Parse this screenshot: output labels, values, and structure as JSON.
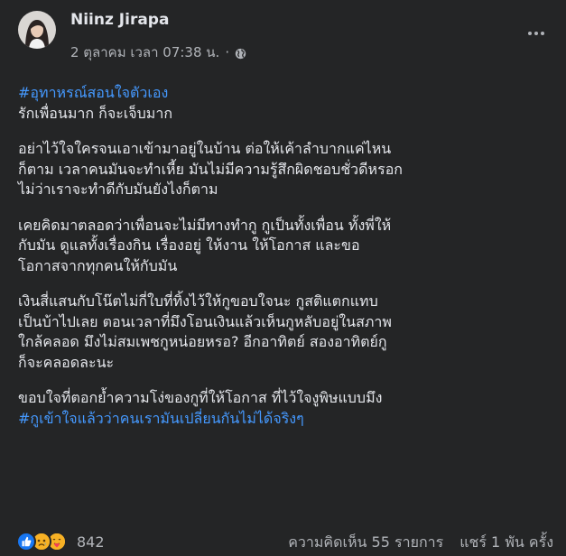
{
  "post": {
    "author": "Niinz Jirapa",
    "timestamp": "2 ตุลาคม เวลา 07:38 น.",
    "meta_separator": "·",
    "privacy_icon": "globe-icon",
    "body": {
      "p1_hashtag": "#อุทาหรณ์สอนใจตัวเอง",
      "p1_line": "รักเพื่อนมาก ก็จะเจ็บมาก",
      "p2_l1": "อย่าไว้ใจใครจนเอาเข้ามาอยู่ในบ้าน ต่อให้เค้าลำบากแค่ไหน",
      "p2_l2": "ก็ตาม เวลาคนมันจะทำเหี้ย มันไม่มีความรู้สึกผิดชอบชั่วดีหรอก",
      "p2_l3": "ไม่ว่าเราจะทำดีกับมันยังไงก็ตาม",
      "p3_l1": "เคยคิดมาตลอดว่าเพื่อนจะไม่มีทางทำกู กูเป็นทั้งเพื่อน ทั้งพี่ให้",
      "p3_l2": "กับมัน ดูแลทั้งเรื่องกิน เรื่องอยู่ ให้งาน ให้โอกาส และขอ",
      "p3_l3": "โอกาสจากทุกคนให้กับมัน",
      "p4_l1": "เงินสี่แสนกับโน๊ตไม่กี่ใบที่ทิ้งไว้ให้กูขอบใจนะ กูสติแตกแทบ",
      "p4_l2": "เป็นบ้าไปเลย ตอนเวลาที่มึงโอนเงินแล้วเห็นกูหลับอยู่ในสภาพ",
      "p4_l3": "ใกล้คลอด มึงไม่สมเพชกูหน่อยหรอ? อีกอาทิตย์ สองอาทิตย์กู",
      "p4_l4": "ก็จะคลอดละนะ",
      "p5_line": "ขอบใจที่ตอกย้ำความโง่ของกูที่ให้โอกาส ที่ไว้ใจงูพิษแบบมึง",
      "p5_hashtag": "#กูเข้าใจแล้วว่าคนเรามันเปลี่ยนกันไม่ได้จริงๆ"
    },
    "footer": {
      "reactions": [
        "like-icon",
        "sad-icon",
        "care-icon"
      ],
      "reaction_count": "842",
      "comments": "ความคิดเห็น 55 รายการ",
      "shares": "แชร์ 1 พัน ครั้ง"
    }
  },
  "colors": {
    "background": "#242526",
    "text_primary": "#e4e6eb",
    "text_secondary": "#b0b3b8",
    "hashtag": "#4599ff",
    "like_blue": "#1877f2",
    "emoji_yellow": "#f7b125"
  }
}
